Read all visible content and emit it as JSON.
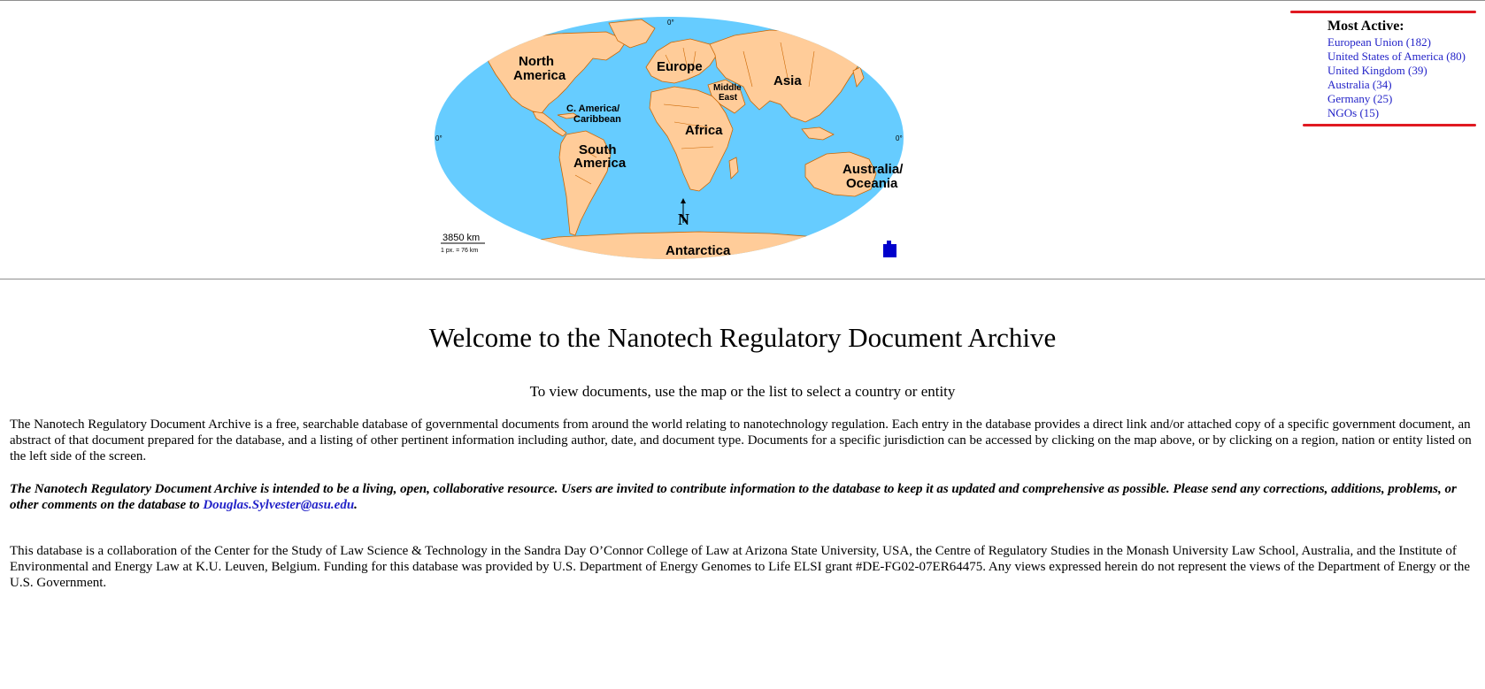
{
  "map": {
    "regions": {
      "north_america": [
        "North",
        "America"
      ],
      "europe": "Europe",
      "middle_east": [
        "Middle",
        "East"
      ],
      "asia": "Asia",
      "central_america": [
        "C. America/",
        "Caribbean"
      ],
      "africa": "Africa",
      "south_america": [
        "South",
        "America"
      ],
      "oceania": [
        "Australia/",
        "Oceania"
      ],
      "antarctica": "Antarctica"
    },
    "compass": "N",
    "scale_distance": "3850 km",
    "scale_ratio": "1 px. = 76 km",
    "graticule": {
      "top": "0°",
      "left": "0°",
      "right": "0°"
    },
    "colors": {
      "ocean": "#66ccff",
      "land": "#ffcc99",
      "border": "#cc6600"
    }
  },
  "most_active": {
    "title": "Most Active:",
    "items": [
      "European Union (182)",
      "United States of America (80)",
      "United Kingdom (39)",
      "Australia (34)",
      "Germany (25)",
      "NGOs (15)"
    ],
    "colors": {
      "accent": "#e01a22",
      "link": "#2323c8"
    }
  },
  "header": {
    "title": "Welcome to the Nanotech Regulatory Document Archive",
    "instruction": "To view documents, use the map or the list to select a country or entity"
  },
  "content": {
    "intro": "The Nanotech Regulatory Document Archive is a free, searchable database of governmental documents from around the world relating to nanotechnology regulation. Each entry in the database provides a direct link and/or attached copy of a specific government document, an abstract of that document prepared for the database, and a listing of other pertinent information including author, date, and document type. Documents for a specific jurisdiction can be accessed by clicking on the map above, or by clicking on a region, nation or entity listed on the left side of the screen.",
    "call_to_action": "The Nanotech Regulatory Document Archive is intended to be a living, open, collaborative resource. Users are invited to contribute information to the database to keep it as updated and comprehensive as possible. Please send any corrections, additions, problems, or other comments on the database to ",
    "email": "Douglas.Sylvester@asu.edu",
    "email_suffix": ".",
    "collaboration": "This database is a collaboration of the Center for the Study of Law Science & Technology in the Sandra Day O’Connor College of Law at Arizona State University, USA, the Centre of Regulatory Studies in the Monash University Law School, Australia, and the Institute of Environmental and Energy Law at K.U. Leuven, Belgium. Funding for this database was provided by U.S. Department of Energy Genomes to Life ELSI grant #DE-FG02-07ER64475. Any views expressed herein do not represent the views of the Department of Energy or the U.S. Government."
  }
}
